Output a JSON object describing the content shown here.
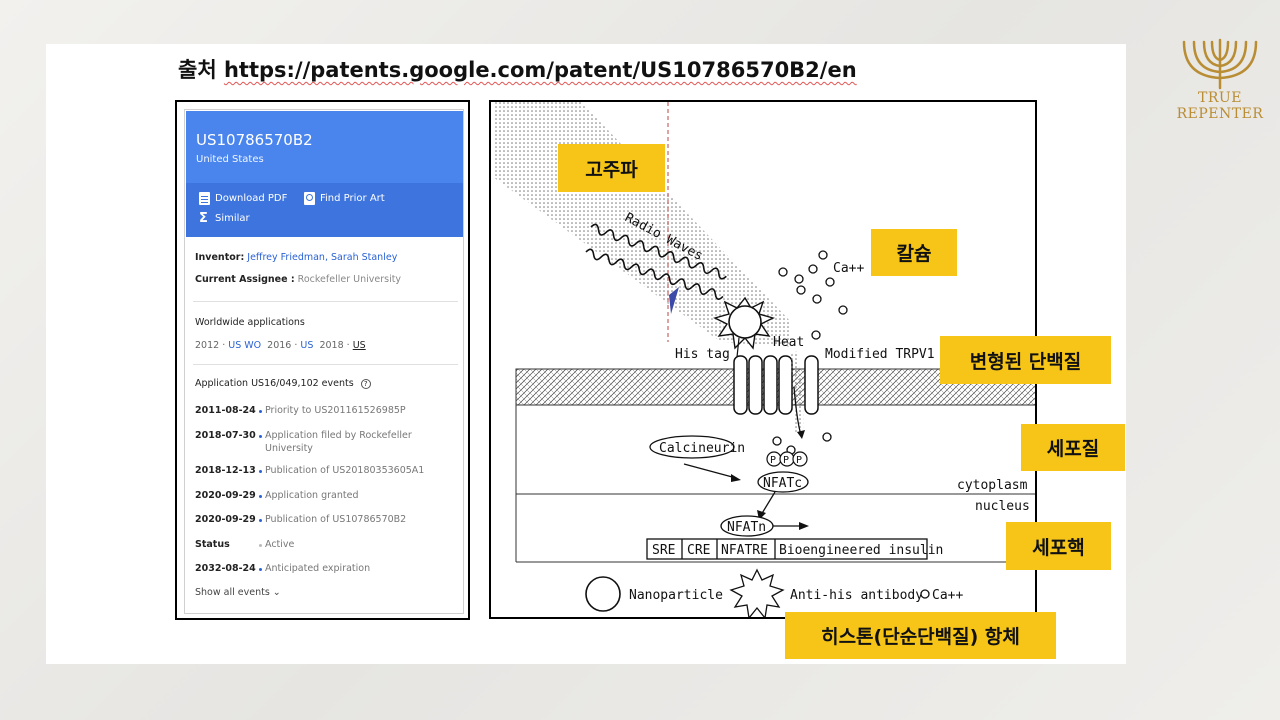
{
  "source": {
    "prefix": "출처",
    "url": "https://patents.google.com/patent/US10786570B2/en"
  },
  "patent": {
    "number": "US10786570B2",
    "country": "United States",
    "actions": {
      "download": "Download PDF",
      "prior_art": "Find Prior Art",
      "similar": "Similar"
    },
    "inventor_label": "Inventor:",
    "inventors": "Jeffrey Friedman, Sarah Stanley",
    "assignee_label": "Current Assignee :",
    "assignee": "Rockefeller University",
    "worldwide_label": "Worldwide applications",
    "worldwide": {
      "y1": "2012",
      "c1": "US WO",
      "y2": "2016",
      "c2": "US",
      "y3": "2018",
      "c3": "US"
    },
    "events_title": "Application US16/049,102 events",
    "events": [
      {
        "date": "2011-08-24",
        "text": "Priority to US201161526985P"
      },
      {
        "date": "2018-07-30",
        "text": "Application filed by Rockefeller",
        "text2": "University"
      },
      {
        "date": "2018-12-13",
        "text": "Publication of US20180353605A1"
      },
      {
        "date": "2020-09-29",
        "text": "Application granted"
      },
      {
        "date": "2020-09-29",
        "text": "Publication of US10786570B2"
      },
      {
        "date": "Status",
        "text": "Active"
      },
      {
        "date": "2032-08-24",
        "text": "Anticipated expiration"
      }
    ],
    "show_all": "Show all events ⌄"
  },
  "diagram": {
    "radio_waves": "Radio  Waves",
    "ca": "Ca++",
    "heat": "Heat",
    "his_tag": "His tag",
    "modified_trpv1": "Modified TRPV1",
    "calcineurin": "Calcineurin",
    "ppp": [
      "P",
      "P",
      "P"
    ],
    "nfatc": "NFATc",
    "cytoplasm": "cytoplasm",
    "nucleus": "nucleus",
    "nfatn": "NFATn",
    "gene": [
      "SRE",
      "CRE",
      "NFATRE",
      "Bioengineered insulin"
    ],
    "legend_nano": "Nanoparticle",
    "legend_antibody": "Anti-his antibody",
    "legend_ca": "Ca++"
  },
  "labels": {
    "radio": "고주파",
    "calcium": "칼슘",
    "protein": "변형된 단백질",
    "cytoplasm": "세포질",
    "nucleus": "세포핵",
    "antibody": "히스톤(단순단백질) 항체"
  },
  "logo": {
    "line1": "TRUE",
    "line2": "REPENTER"
  },
  "colors": {
    "yellow": "#f6c518",
    "patent_blue": "#4a85ee",
    "gold": "#b98d34"
  }
}
